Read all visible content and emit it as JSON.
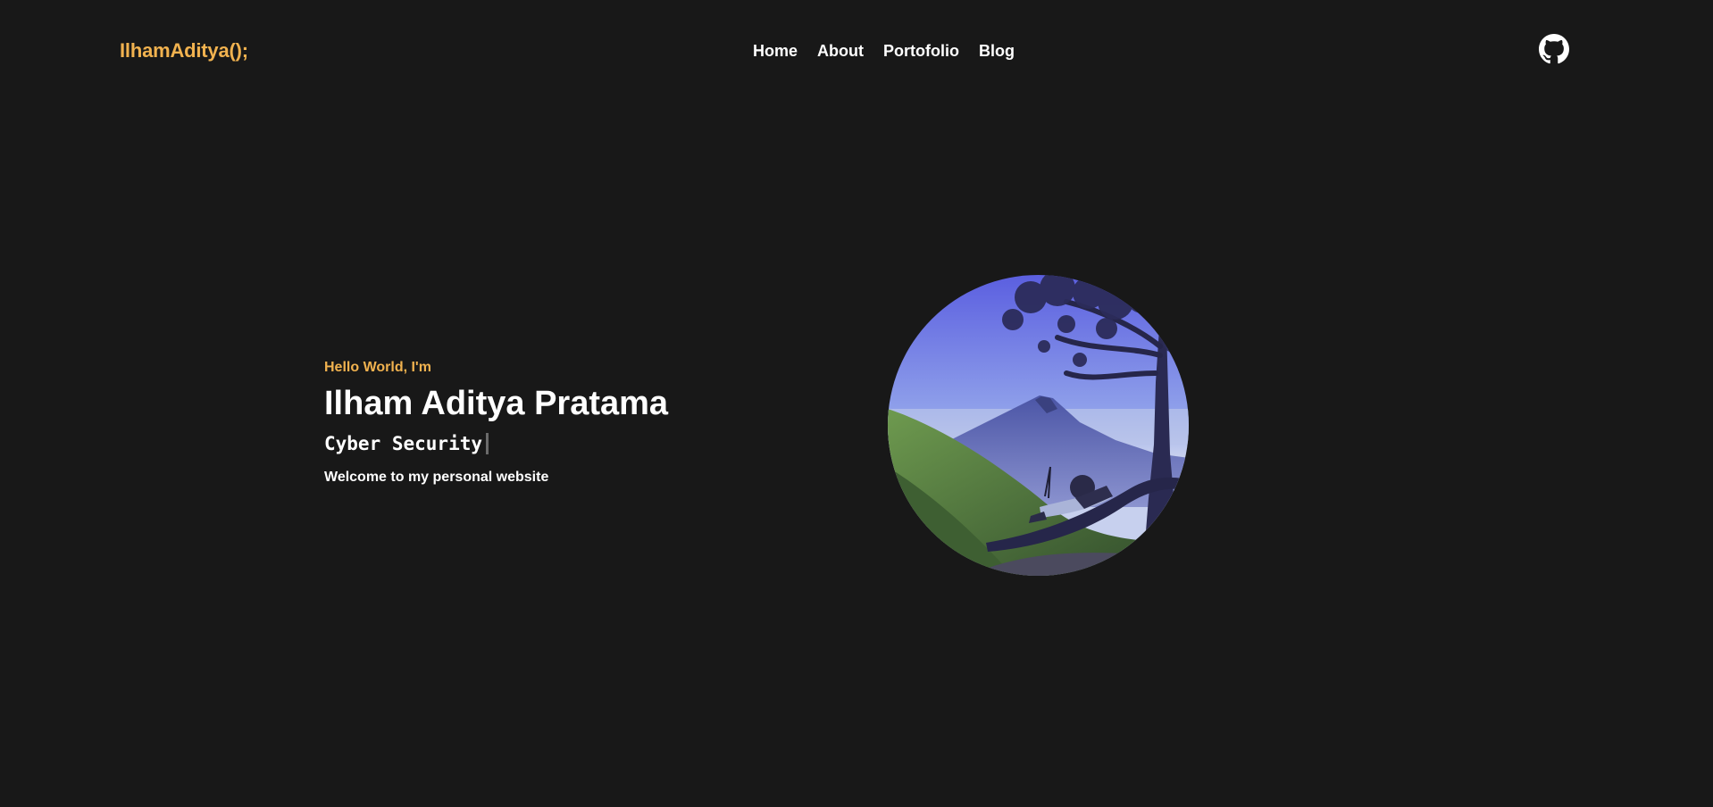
{
  "header": {
    "logo_text": "IlhamAditya();",
    "nav": [
      {
        "label": "Home"
      },
      {
        "label": "About"
      },
      {
        "label": "Portofolio"
      },
      {
        "label": "Blog"
      }
    ],
    "social_icon": "github-icon"
  },
  "hero": {
    "greeting": "Hello World, I'm",
    "name": "Ilham Aditya Pratama",
    "role": "Cyber Security",
    "welcome": "Welcome to my personal website",
    "photo_icon": "profile-photo"
  },
  "colors": {
    "background": "#181818",
    "accent": "#f1b24f",
    "text": "#ffffff",
    "cursor": "#6a6a6a"
  }
}
